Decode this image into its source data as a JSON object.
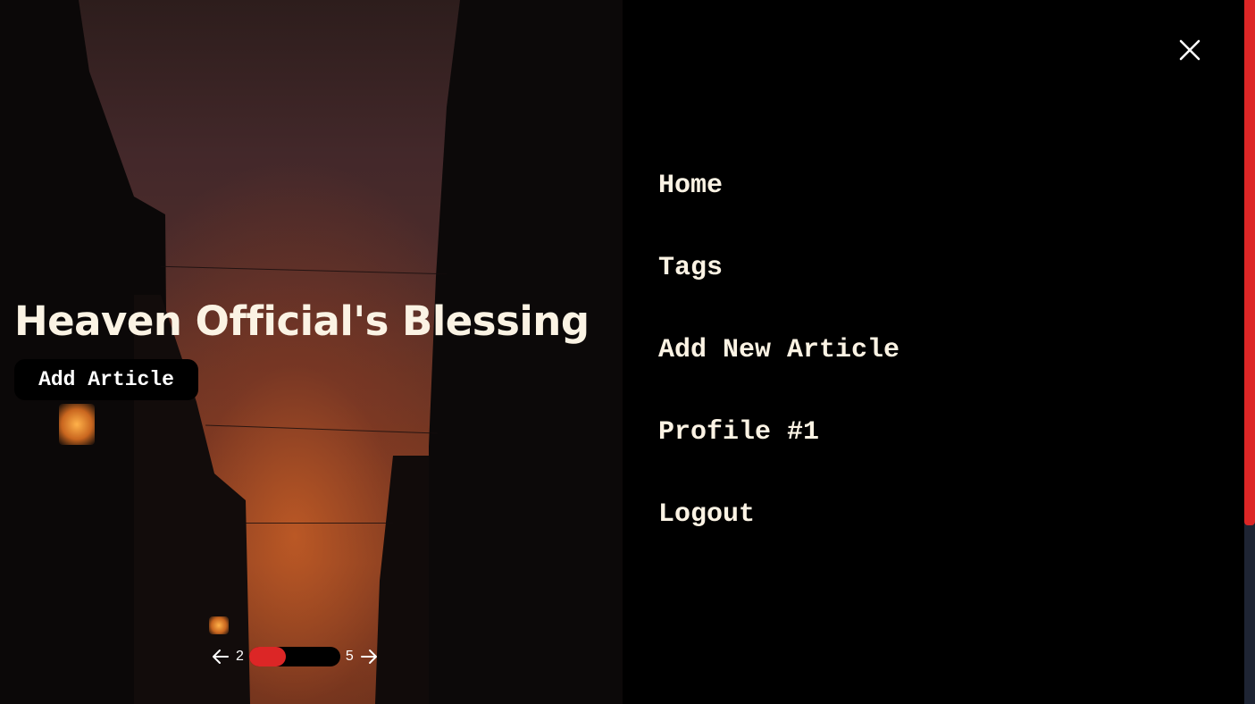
{
  "hero": {
    "title": "Heaven Official's Blessing",
    "add_article_label": "Add Article"
  },
  "pager": {
    "current": "2",
    "total": "5",
    "progress_fraction": 0.4,
    "prev_icon": "arrow-left-icon",
    "next_icon": "arrow-right-icon"
  },
  "nav": {
    "close_icon": "close-icon",
    "items": [
      {
        "label": "Home"
      },
      {
        "label": "Tags"
      },
      {
        "label": "Add New Article"
      },
      {
        "label": "Profile #1"
      },
      {
        "label": "Logout"
      }
    ]
  },
  "scrollbar": {
    "position_fraction": 0.0
  },
  "colors": {
    "accent": "#dc2626",
    "text_light": "#fbf3e4",
    "panel_bg": "#000000"
  }
}
